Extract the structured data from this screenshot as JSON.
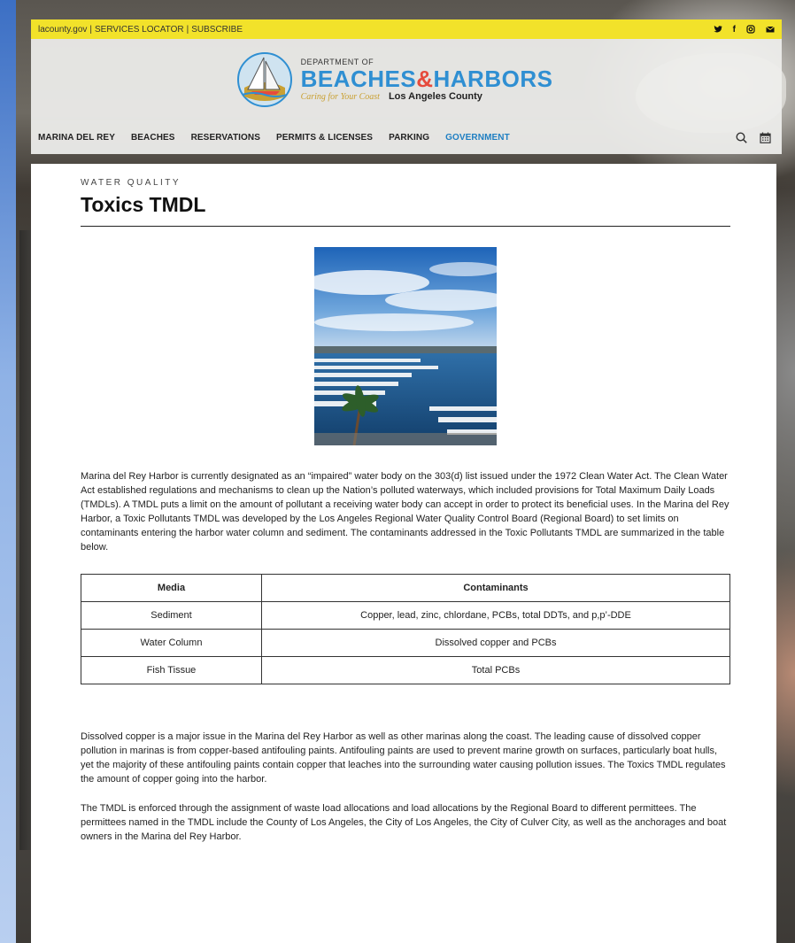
{
  "header": {
    "utility_links": [
      "lacounty.gov",
      "SERVICES LOCATOR",
      "SUBSCRIBE"
    ],
    "utility_separator": "|",
    "social_icons": [
      "twitter-icon",
      "facebook-icon",
      "instagram-icon",
      "email-icon"
    ],
    "social_glyphs": {
      "twitter": "🐦",
      "facebook": "f",
      "instagram": "◎",
      "email": "✉"
    },
    "logo": {
      "dept": "DEPARTMENT OF",
      "word1": "BEACHES",
      "amp": "&",
      "word2": "HARBORS",
      "tagline": "Caring for Your Coast",
      "county": "Los Angeles County"
    },
    "nav": [
      {
        "label": "MARINA DEL REY",
        "active": false
      },
      {
        "label": "BEACHES",
        "active": false
      },
      {
        "label": "RESERVATIONS",
        "active": false
      },
      {
        "label": "PERMITS & LICENSES",
        "active": false
      },
      {
        "label": "PARKING",
        "active": false
      },
      {
        "label": "GOVERNMENT",
        "active": true
      }
    ],
    "tools": [
      "search-icon",
      "calendar-icon"
    ]
  },
  "colors": {
    "topbar": "#f2e22a",
    "brand_blue": "#2f8fd2",
    "brand_red": "#e64b3c",
    "nav_active": "#1f7fc2"
  },
  "content": {
    "eyebrow": "WATER QUALITY",
    "title": "Toxics TMDL",
    "intro": "Marina del Rey Harbor is currently designated as an “impaired” water body on the 303(d) list issued under the 1972 Clean Water Act. The Clean Water Act established regulations and mechanisms to clean up the Nation’s polluted waterways, which included provisions for Total Maximum Daily Loads (TMDLs). A TMDL puts a limit on the amount of pollutant a receiving water body can accept in order to protect its beneficial uses. In the Marina del Rey Harbor, a Toxic Pollutants TMDL was developed by the Los Angeles Regional Water Quality Control Board (Regional Board) to set limits on contaminants entering the harbor water column and sediment.  The contaminants addressed in the Toxic Pollutants TMDL are summarized in the table below.",
    "table": {
      "headers": [
        "Media",
        "Contaminants"
      ],
      "rows": [
        [
          "Sediment",
          "Copper, lead, zinc, chlordane, PCBs, total DDTs, and p,p’-DDE"
        ],
        [
          "Water Column",
          "Dissolved copper and PCBs"
        ],
        [
          "Fish Tissue",
          "Total PCBs"
        ]
      ]
    },
    "paragraph2": "Dissolved copper is a major issue in the Marina del Rey Harbor as well as other marinas along the coast. The leading cause of dissolved copper pollution in marinas is from copper-based antifouling paints. Antifouling paints are used to prevent marine growth on surfaces, particularly boat hulls, yet the majority of these antifouling paints contain copper that leaches into the surrounding water causing pollution issues. The Toxics TMDL regulates the amount of copper going into the harbor.",
    "paragraph3": "The TMDL is enforced through the assignment of waste load allocations and load allocations by the Regional Board to different permittees. The permittees named in the TMDL include the County of Los Angeles, the City of Los Angeles, the City of Culver City, as well as the anchorages and boat owners in the Marina del Rey Harbor."
  }
}
